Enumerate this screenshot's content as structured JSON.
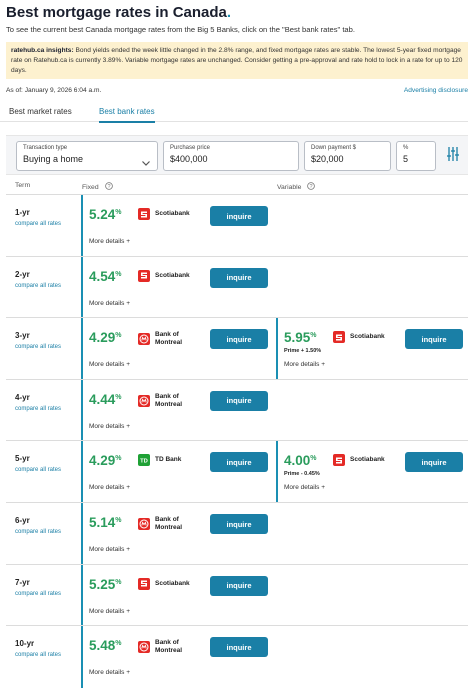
{
  "header": {
    "title": "Best mortgage rates in Canada",
    "title_dot": ".",
    "subtitle": "To see the current best Canada mortgage rates from the Big 5 Banks, click on the \"Best bank rates\" tab."
  },
  "insights": {
    "label": "ratehub.ca insights:",
    "text": " Bond yields ended the week little changed in the 2.8% range, and fixed mortgage rates are stable. The lowest 5-year fixed mortgage rate on Ratehub.ca is currently 3.89%. Variable mortgage rates are unchanged. Consider getting a pre-approval and rate hold to lock in a rate for up to 120 days."
  },
  "as_of": "As of: January 9, 2026 6:04 a.m.",
  "advertising_link": "Advertising disclosure",
  "tabs": [
    {
      "label": "Best market rates",
      "active": false
    },
    {
      "label": "Best bank rates",
      "active": true
    }
  ],
  "filters": {
    "transaction_type": {
      "label": "Transaction type",
      "value": "Buying a home"
    },
    "purchase_price": {
      "label": "Purchase price",
      "value": "$400,000"
    },
    "down_payment": {
      "label": "Down payment $",
      "value": "$20,000"
    },
    "percent": {
      "label": "%",
      "value": "5"
    }
  },
  "columns": {
    "term": "Term",
    "fixed": "Fixed",
    "variable": "Variable"
  },
  "common": {
    "compare": "compare all rates",
    "more_details": "More details +",
    "inquire": "inquire"
  },
  "colors": {
    "accent": "#1a7fa6",
    "rate_green": "#2a9c5c",
    "insight_bg": "#fdf1cf",
    "scotiabank_red": "#e42a26",
    "td_green": "#1fa135"
  },
  "rows": [
    {
      "term": "1-yr",
      "fixed": {
        "rate": "5.24",
        "unit": "%",
        "lender": "Scotiabank",
        "logo": "scotiabank-logo"
      }
    },
    {
      "term": "2-yr",
      "fixed": {
        "rate": "4.54",
        "unit": "%",
        "lender": "Scotiabank",
        "logo": "scotiabank-logo"
      }
    },
    {
      "term": "3-yr",
      "fixed": {
        "rate": "4.29",
        "unit": "%",
        "lender": "Bank of Montreal",
        "logo": "bmo-logo"
      },
      "variable": {
        "rate": "5.95",
        "unit": "%",
        "sub": "Prime + 1.50%",
        "lender": "Scotiabank",
        "logo": "scotiabank-logo"
      }
    },
    {
      "term": "4-yr",
      "fixed": {
        "rate": "4.44",
        "unit": "%",
        "lender": "Bank of Montreal",
        "logo": "bmo-logo"
      }
    },
    {
      "term": "5-yr",
      "fixed": {
        "rate": "4.29",
        "unit": "%",
        "lender": "TD Bank",
        "logo": "td-logo"
      },
      "variable": {
        "rate": "4.00",
        "unit": "%",
        "sub": "Prime - 0.45%",
        "lender": "Scotiabank",
        "logo": "scotiabank-logo"
      }
    },
    {
      "term": "6-yr",
      "fixed": {
        "rate": "5.14",
        "unit": "%",
        "lender": "Bank of Montreal",
        "logo": "bmo-logo"
      }
    },
    {
      "term": "7-yr",
      "fixed": {
        "rate": "5.25",
        "unit": "%",
        "lender": "Scotiabank",
        "logo": "scotiabank-logo"
      }
    },
    {
      "term": "10-yr",
      "fixed": {
        "rate": "5.48",
        "unit": "%",
        "lender": "Bank of Montreal",
        "logo": "bmo-logo"
      }
    }
  ]
}
